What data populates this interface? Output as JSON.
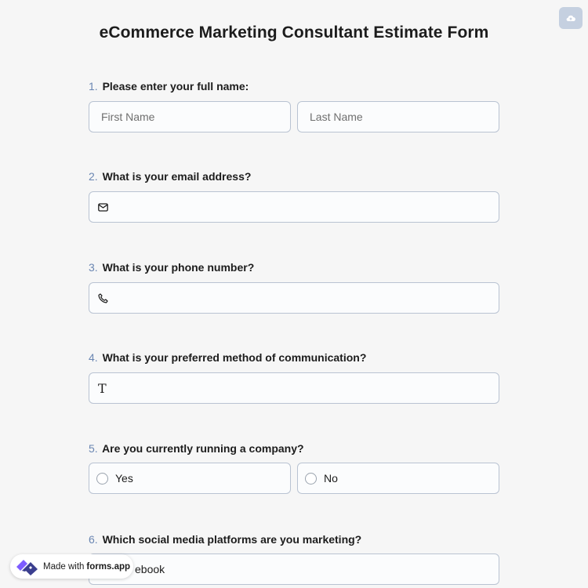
{
  "form": {
    "title": "eCommerce Marketing Consultant Estimate Form"
  },
  "toolbar": {
    "save_icon": "cloud-upload-icon"
  },
  "questions": [
    {
      "number": "1.",
      "label": "Please enter your full name:",
      "first_placeholder": "First Name",
      "last_placeholder": "Last Name"
    },
    {
      "number": "2.",
      "label": "What is your email address?",
      "icon": "envelope-icon",
      "value": ""
    },
    {
      "number": "3.",
      "label": "What is your phone number?",
      "icon": "phone-icon",
      "value": ""
    },
    {
      "number": "4.",
      "label": "What is your preferred method of communication?",
      "icon": "text-icon",
      "icon_glyph": "T",
      "value": ""
    },
    {
      "number": "5.",
      "label": "Are you currently running a company?",
      "options": [
        "Yes",
        "No"
      ]
    },
    {
      "number": "6.",
      "label": "Which social media platforms are you marketing?",
      "options": [
        "ebook"
      ]
    }
  ],
  "badge": {
    "prefix": "Made with",
    "brand": "forms.app"
  },
  "colors": {
    "accent": "#6a86b2",
    "border": "#b9c3d2",
    "save_button": "#c5d0e0",
    "logo_dark": "#3b3f8f",
    "logo_purple": "#7d5cff"
  }
}
